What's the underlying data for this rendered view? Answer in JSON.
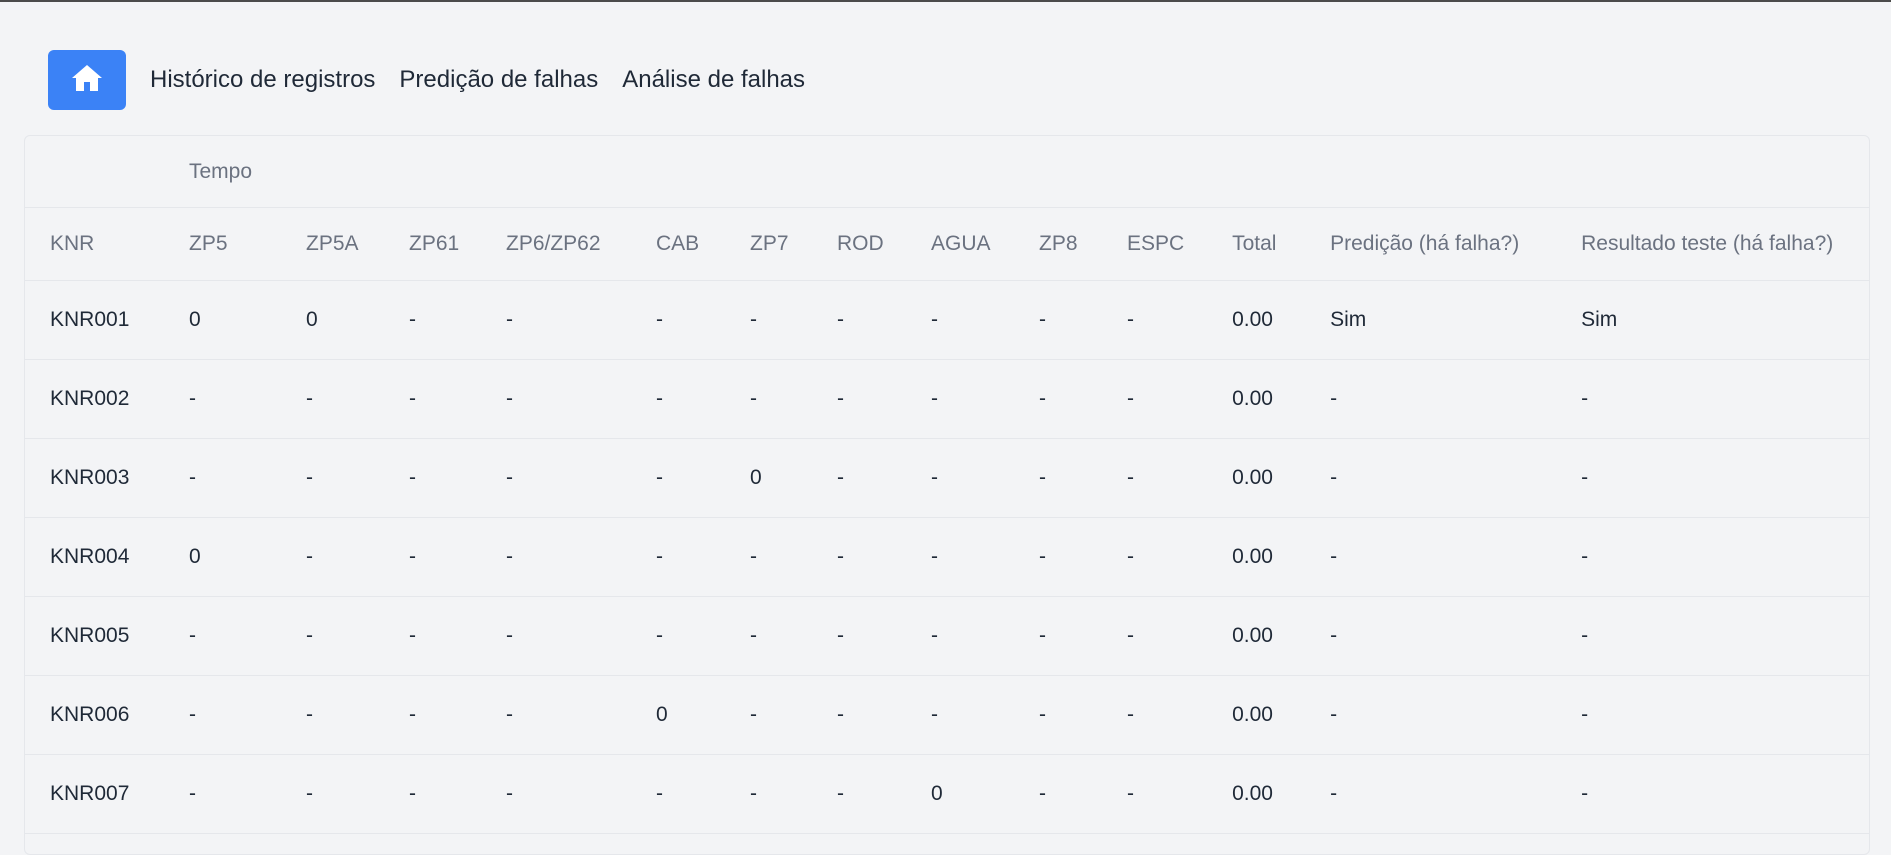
{
  "nav": {
    "home_icon": "home-icon",
    "links": [
      "Histórico de registros",
      "Predição de falhas",
      "Análise de falhas"
    ]
  },
  "colors": {
    "accent": "#3b82f6",
    "background": "#f3f4f6",
    "header_text": "#6b7280",
    "body_text": "#1f2937"
  },
  "table": {
    "group_header": "Tempo",
    "columns": [
      "KNR",
      "ZP5",
      "ZP5A",
      "ZP61",
      "ZP6/ZP62",
      "CAB",
      "ZP7",
      "ROD",
      "AGUA",
      "ZP8",
      "ESPC",
      "Total",
      "Predição (há falha?)",
      "Resultado teste (há falha?)"
    ],
    "rows": [
      [
        "KNR001",
        "0",
        "0",
        "-",
        "-",
        "-",
        "-",
        "-",
        "-",
        "-",
        "-",
        "0.00",
        "Sim",
        "Sim"
      ],
      [
        "KNR002",
        "-",
        "-",
        "-",
        "-",
        "-",
        "-",
        "-",
        "-",
        "-",
        "-",
        "0.00",
        "-",
        "-"
      ],
      [
        "KNR003",
        "-",
        "-",
        "-",
        "-",
        "-",
        "0",
        "-",
        "-",
        "-",
        "-",
        "0.00",
        "-",
        "-"
      ],
      [
        "KNR004",
        "0",
        "-",
        "-",
        "-",
        "-",
        "-",
        "-",
        "-",
        "-",
        "-",
        "0.00",
        "-",
        "-"
      ],
      [
        "KNR005",
        "-",
        "-",
        "-",
        "-",
        "-",
        "-",
        "-",
        "-",
        "-",
        "-",
        "0.00",
        "-",
        "-"
      ],
      [
        "KNR006",
        "-",
        "-",
        "-",
        "-",
        "0",
        "-",
        "-",
        "-",
        "-",
        "-",
        "0.00",
        "-",
        "-"
      ],
      [
        "KNR007",
        "-",
        "-",
        "-",
        "-",
        "-",
        "-",
        "-",
        "0",
        "-",
        "-",
        "0.00",
        "-",
        "-"
      ]
    ]
  }
}
